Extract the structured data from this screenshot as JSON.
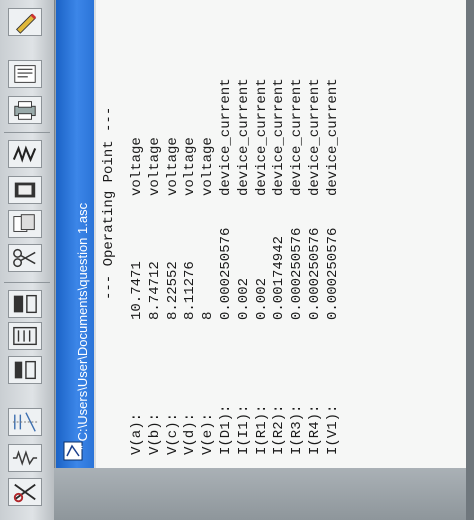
{
  "window": {
    "title": "* C:\\Users\\User\\Documents\\question 1.asc"
  },
  "output": {
    "header": "--- Operating Point ---",
    "rows": [
      {
        "name": "V(a):",
        "value": "10.7471",
        "type": "voltage"
      },
      {
        "name": "V(b):",
        "value": "8.74712",
        "type": "voltage"
      },
      {
        "name": "V(c):",
        "value": "8.22552",
        "type": "voltage"
      },
      {
        "name": "V(d):",
        "value": "8.11276",
        "type": "voltage"
      },
      {
        "name": "V(e):",
        "value": "8",
        "type": "voltage"
      },
      {
        "name": "I(D1):",
        "value": "0.000250576",
        "type": "device_current"
      },
      {
        "name": "I(I1):",
        "value": "0.002",
        "type": "device_current"
      },
      {
        "name": "I(R1):",
        "value": "0.002",
        "type": "device_current"
      },
      {
        "name": "I(R2):",
        "value": "0.00174942",
        "type": "device_current"
      },
      {
        "name": "I(R3):",
        "value": "0.000250576",
        "type": "device_current"
      },
      {
        "name": "I(R4):",
        "value": "0.000250576",
        "type": "device_current"
      },
      {
        "name": "I(V1):",
        "value": "0.000250576",
        "type": "device_current"
      }
    ]
  },
  "toolbar": {
    "icons": [
      "resistor-icon",
      "capacitor-icon",
      "inductor-icon",
      "diode-icon",
      "component-icon",
      "move-icon",
      "drag-icon",
      "undo-icon",
      "redo-icon",
      "rotate-icon",
      "mirror-icon",
      "text-icon",
      "spice-directive-icon",
      "cut-icon",
      "copy-icon",
      "paste-icon",
      "find-icon",
      "print-icon",
      "pencil-icon"
    ]
  }
}
